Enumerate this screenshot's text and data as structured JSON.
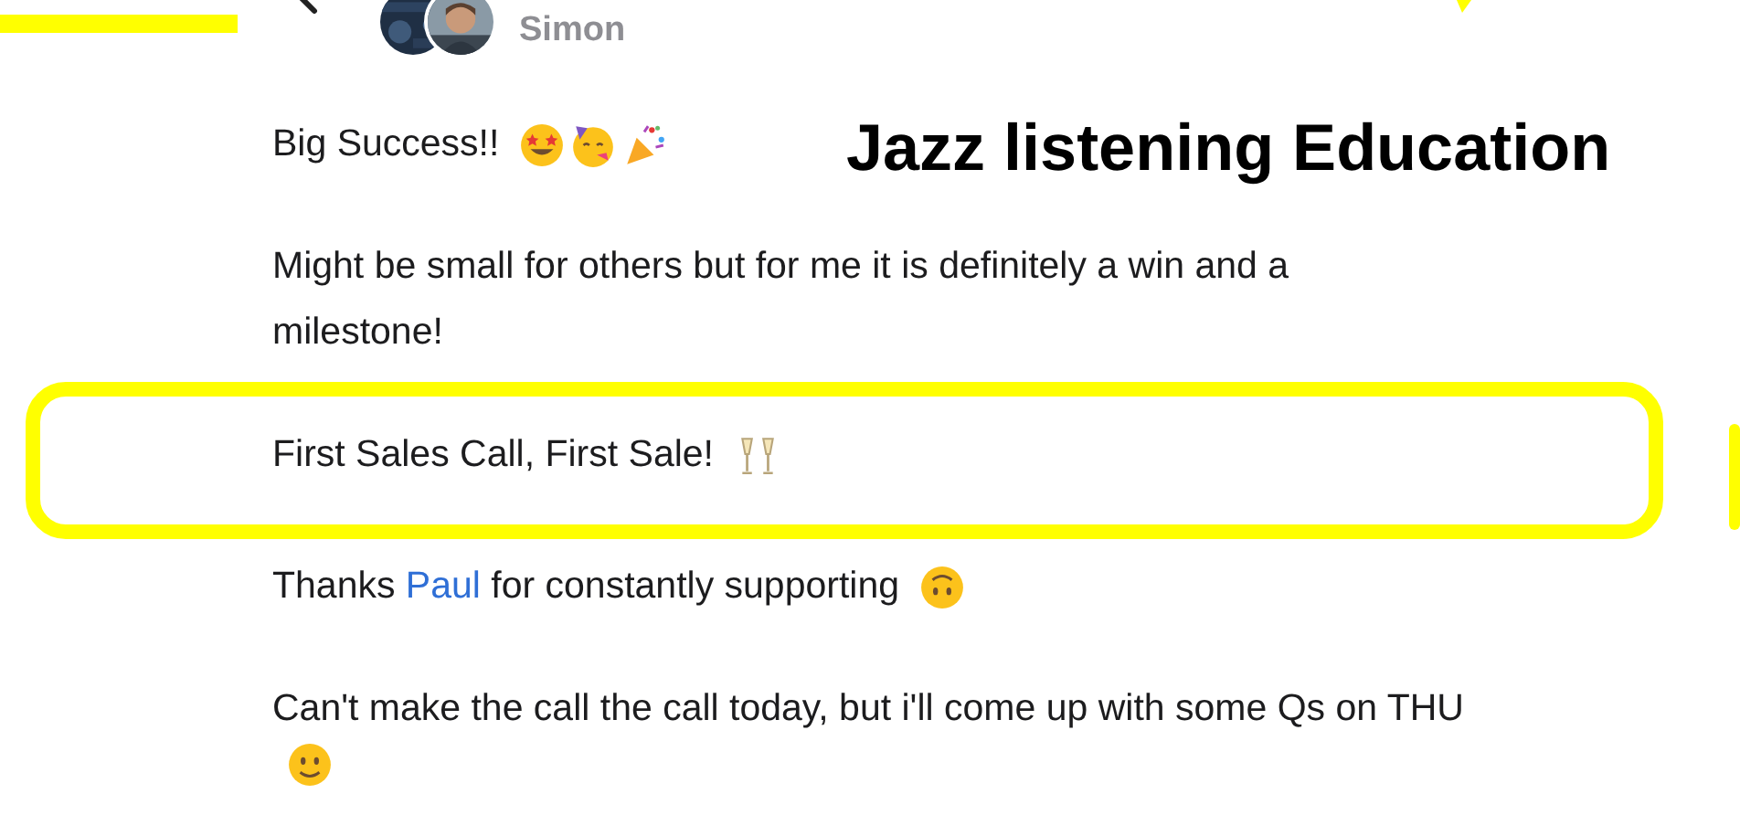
{
  "header": {
    "author": "Simon"
  },
  "post": {
    "paragraphs": [
      {
        "segments": [
          {
            "kind": "text",
            "text": "Big Success!!"
          },
          {
            "kind": "star-struck"
          },
          {
            "kind": "party-face"
          },
          {
            "kind": "party-popper"
          }
        ]
      },
      {
        "segments": [
          {
            "kind": "text",
            "text": "Might be small for others but for me it is definitely a win and a milestone!"
          }
        ]
      },
      {
        "segments": [
          {
            "kind": "text",
            "text": "First Sales Call, First Sale!"
          },
          {
            "kind": "champagne"
          }
        ]
      },
      {
        "segments": [
          {
            "kind": "text",
            "text": "Thanks "
          },
          {
            "kind": "link",
            "text": "Paul"
          },
          {
            "kind": "text",
            "text": " for constantly supporting"
          },
          {
            "kind": "upside-down"
          }
        ]
      },
      {
        "segments": [
          {
            "kind": "text",
            "text": "Can't make the call the call today, but i'll come up with some Qs on THU"
          },
          {
            "kind": "smile"
          }
        ]
      }
    ]
  },
  "annotation": {
    "caption": "Jazz listening Education"
  }
}
